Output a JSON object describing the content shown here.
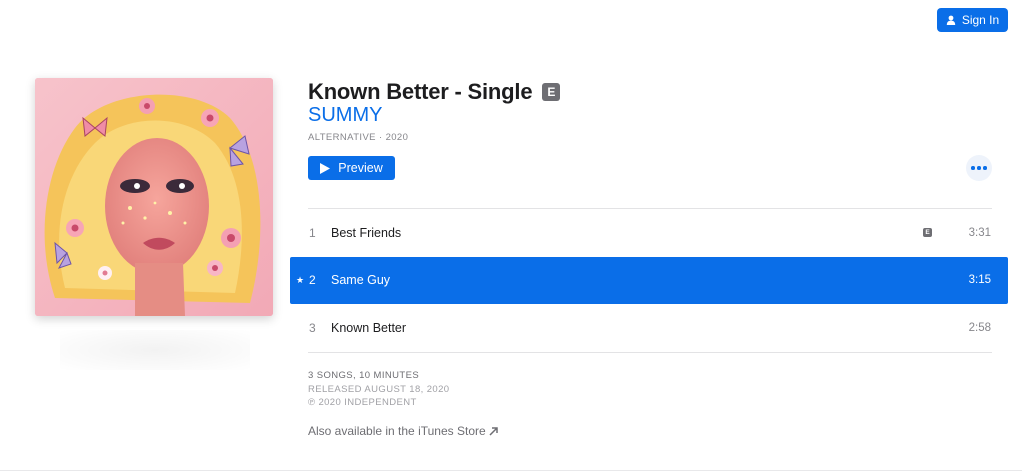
{
  "header": {
    "sign_in_label": "Sign In",
    "sign_in_icon": "person-icon"
  },
  "album": {
    "title": "Known Better - Single",
    "explicit_badge": "E",
    "artist": "SUMMY",
    "meta": "ALTERNATIVE · 2020",
    "preview_label": "Preview",
    "accent_color": "#0a6ee8"
  },
  "tracks": [
    {
      "number": "1",
      "name": "Best Friends",
      "duration": "3:31",
      "explicit": "E",
      "selected": false
    },
    {
      "number": "2",
      "name": "Same Guy",
      "duration": "3:15",
      "explicit": "",
      "selected": true,
      "marker": "★"
    },
    {
      "number": "3",
      "name": "Known Better",
      "duration": "2:58",
      "explicit": "",
      "selected": false
    }
  ],
  "footer": {
    "songs": "3 SONGS, 10 MINUTES",
    "released": "RELEASED  AUGUST 18, 2020",
    "copyright": "℗ 2020 INDEPENDENT",
    "itunes_link": "Also available in the iTunes Store"
  }
}
